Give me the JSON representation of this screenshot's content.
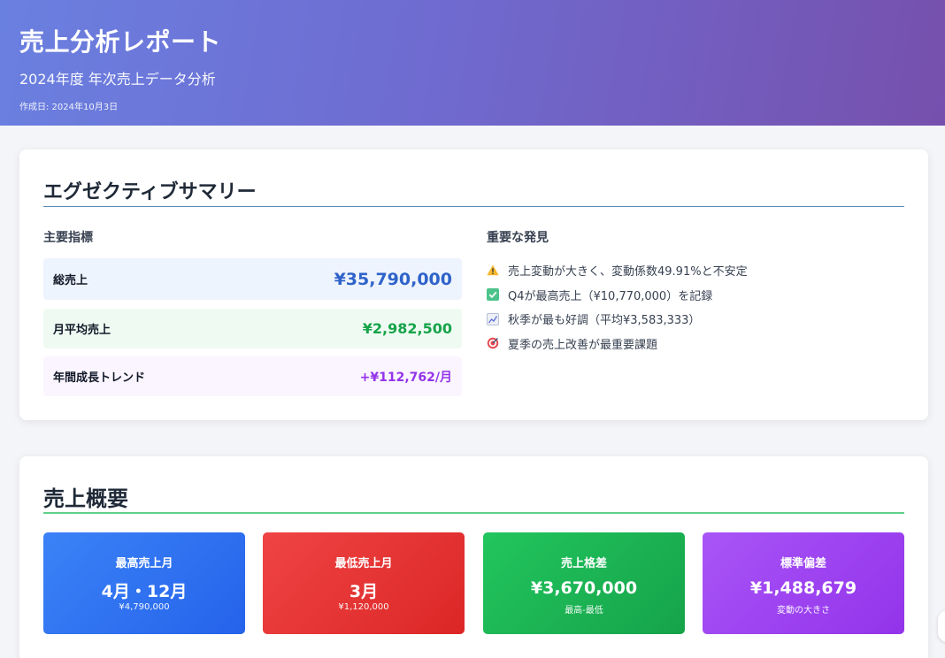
{
  "header": {
    "title": "売上分析レポート",
    "subtitle": "2024年度 年次売上データ分析",
    "date": "作成日: 2024年10月3日"
  },
  "summary": {
    "title": "エグゼクティブサマリー",
    "metrics_label": "主要指標",
    "metrics": [
      {
        "name": "総売上",
        "value": "¥35,790,000"
      },
      {
        "name": "月平均売上",
        "value": "¥2,982,500"
      },
      {
        "name": "年間成長トレンド",
        "value": "+¥112,762/月"
      }
    ],
    "findings_label": "重要な発見",
    "findings": [
      {
        "icon": "warning-icon",
        "text": "売上変動が大きく、変動係数49.91%と不安定"
      },
      {
        "icon": "check-icon",
        "text": "Q4が最高売上（¥10,770,000）を記録"
      },
      {
        "icon": "chart-up-icon",
        "text": "秋季が最も好調（平均¥3,583,333）"
      },
      {
        "icon": "target-icon",
        "text": "夏季の売上改善が最重要課題"
      }
    ]
  },
  "overview": {
    "title": "売上概要",
    "stats": [
      {
        "label": "最高売上月",
        "value": "4月・12月",
        "sub": "¥4,790,000"
      },
      {
        "label": "最低売上月",
        "value": "3月",
        "sub": "¥1,120,000"
      },
      {
        "label": "売上格差",
        "value": "¥3,670,000",
        "sub": "最高-最低"
      },
      {
        "label": "標準偏差",
        "value": "¥1,488,679",
        "sub": "変動の大きさ"
      }
    ]
  }
}
